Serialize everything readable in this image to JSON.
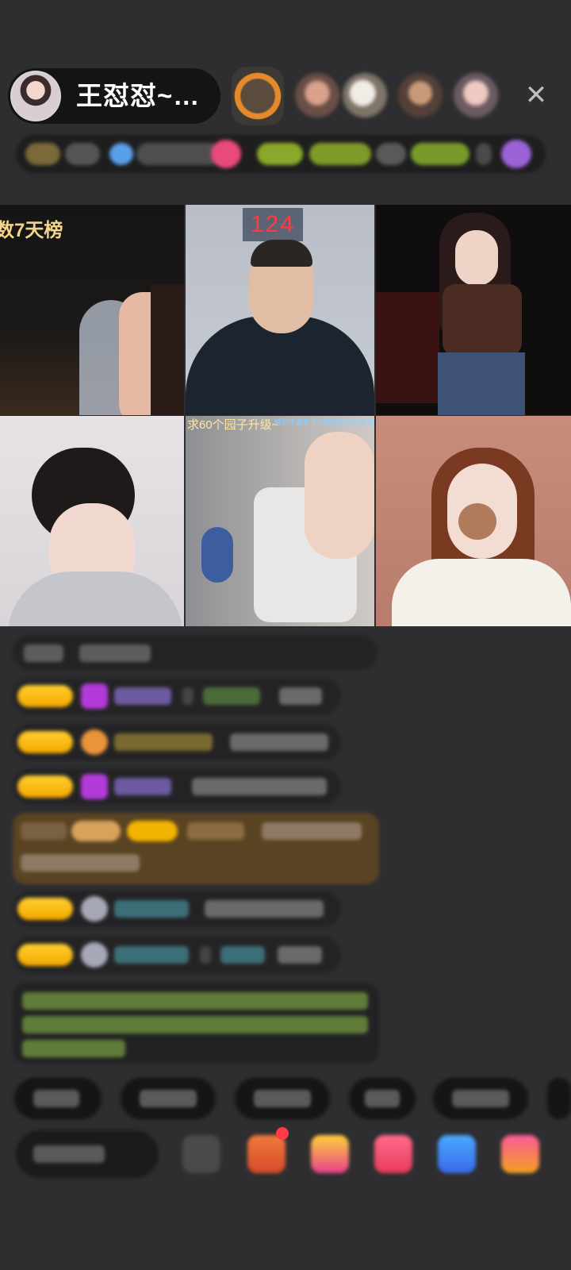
{
  "header": {
    "host_name": "王怼怼~…",
    "close_glyph": "✕"
  },
  "grid": {
    "rank_label": "数7天榜",
    "score": "124",
    "cell5_caption": "求60个园子升级~",
    "cell5_subcaption": "特别不要手里的照来的升级家族"
  },
  "colors": {
    "background": "#2e2e30",
    "badge": "#f2b400",
    "highlight_message": "#5a4322",
    "green_text": "#8bc34a"
  },
  "icons": [
    "close-icon",
    "gift-icon",
    "box-icon",
    "game-icon",
    "chat-icon",
    "more-icon"
  ]
}
